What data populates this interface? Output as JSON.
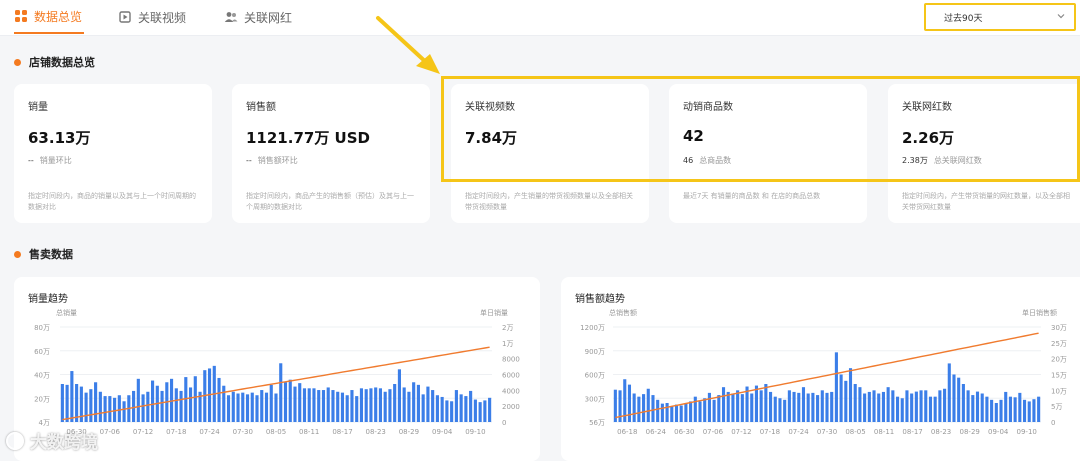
{
  "tabs": [
    {
      "label": "数据总览",
      "icon": "grid-icon"
    },
    {
      "label": "关联视频",
      "icon": "video-icon"
    },
    {
      "label": "关联网红",
      "icon": "users-icon"
    }
  ],
  "period": {
    "value": "过去90天"
  },
  "sections": {
    "overview": "店铺数据总览",
    "sales": "售卖数据"
  },
  "cards": [
    {
      "label": "销量",
      "value": "63.13万",
      "sub_value": "--",
      "sub_label": "销量环比",
      "desc": "指定时间段内，商品的销量以及其与上一个时间周期的数据对比"
    },
    {
      "label": "销售额",
      "value": "1121.77万 USD",
      "sub_value": "--",
      "sub_label": "销售额环比",
      "desc": "指定时间段内，商品产生的销售额（预估）及其与上一个周期的数据对比"
    },
    {
      "label": "关联视频数",
      "value": "7.84万",
      "sub_value": "",
      "sub_label": "",
      "desc": "指定时间段内，产生销量的带货视频数量以及全部相关带货视频数量"
    },
    {
      "label": "动销商品数",
      "value": "42",
      "sub_value": "46",
      "sub_label": "总商品数",
      "desc": "最近7天 有销量的商品数 和 在店的商品总数"
    },
    {
      "label": "关联网红数",
      "value": "2.26万",
      "sub_value": "2.38万",
      "sub_label": "总关联网红数",
      "desc": "指定时间段内，产生带货销量的网红数量，以及全部相关带货网红数量"
    }
  ],
  "watermark": "大数跨境",
  "colors": {
    "accent": "#f47a20",
    "bar": "#3b7ee8",
    "line": "#f07b2f",
    "highlight": "#f5c518"
  },
  "chart_data": [
    {
      "type": "bar",
      "title": "销量趋势",
      "ylabel_left": "总销量",
      "ylabel_right": "单日销量",
      "left_ticks": [
        "80万",
        "60万",
        "40万",
        "20万",
        "4万"
      ],
      "right_ticks": [
        "2万",
        "1万",
        "8000",
        "6000",
        "4000",
        "2000",
        "0"
      ],
      "categories": [
        "06-30",
        "07-06",
        "07-12",
        "07-18",
        "07-24",
        "07-30",
        "08-05",
        "08-11",
        "08-17",
        "08-23",
        "08-29",
        "09-04",
        "09-10"
      ],
      "series": [
        {
          "name": "单日销量",
          "type": "bar",
          "values": [
            4400,
            4300,
            5900,
            4400,
            4100,
            3400,
            3800,
            4600,
            3500,
            3000,
            3000,
            2800,
            3100,
            2400,
            3100,
            3600,
            5000,
            3200,
            3500,
            4800,
            4200,
            3600,
            4600,
            5000,
            3900,
            3600,
            5200,
            4000,
            5300,
            3500,
            6000,
            6200,
            6500,
            5100,
            4200,
            3100,
            3500,
            3300,
            3400,
            3200,
            3400,
            3100,
            3700,
            3400,
            4300,
            3300,
            6800,
            4600,
            4900,
            4100,
            4500,
            3900,
            3900,
            3900,
            3700,
            3700,
            4000,
            3700,
            3500,
            3400,
            3100,
            3700,
            3000,
            3900,
            3800,
            3900,
            4000,
            3900,
            3500,
            3800,
            4400,
            6100,
            4000,
            3500,
            4600,
            4300,
            3200,
            4100,
            3700,
            3100,
            2900,
            2500,
            2400,
            3700,
            3200,
            3000,
            3600,
            2600,
            2300,
            2500,
            2800
          ]
        },
        {
          "name": "总销量",
          "type": "line",
          "values": [
            20000,
            630000
          ]
        }
      ]
    },
    {
      "type": "bar",
      "title": "销售额趋势",
      "ylabel_left": "总销售额",
      "ylabel_right": "单日销售额",
      "left_ticks": [
        "1200万",
        "900万",
        "600万",
        "300万",
        "56万"
      ],
      "right_ticks": [
        "30万",
        "25万",
        "20万",
        "15万",
        "10万",
        "5万",
        "0"
      ],
      "categories": [
        "06-18",
        "06-24",
        "06-30",
        "07-06",
        "07-12",
        "07-18",
        "07-24",
        "07-30",
        "08-05",
        "08-11",
        "08-17",
        "08-23",
        "08-29",
        "09-04",
        "09-10"
      ],
      "series": [
        {
          "name": "单日销售额",
          "type": "bar",
          "values": [
            102000,
            100000,
            135000,
            118000,
            90000,
            80000,
            88000,
            105000,
            85000,
            70000,
            58000,
            60000,
            50000,
            55000,
            52000,
            58000,
            65000,
            80000,
            65000,
            75000,
            92000,
            70000,
            85000,
            110000,
            95000,
            90000,
            100000,
            88000,
            112000,
            90000,
            115000,
            100000,
            120000,
            95000,
            80000,
            75000,
            70000,
            100000,
            95000,
            92000,
            110000,
            90000,
            92000,
            85000,
            100000,
            92000,
            95000,
            220000,
            150000,
            130000,
            170000,
            120000,
            110000,
            90000,
            95000,
            100000,
            90000,
            95000,
            110000,
            100000,
            80000,
            75000,
            100000,
            90000,
            96000,
            100000,
            100000,
            80000,
            80000,
            100000,
            105000,
            185000,
            150000,
            140000,
            120000,
            100000,
            85000,
            96000,
            90000,
            80000,
            70000,
            60000,
            70000,
            95000,
            80000,
            78000,
            92000,
            70000,
            65000,
            72000,
            80000
          ]
        },
        {
          "name": "总销售额",
          "type": "line",
          "values": [
            560000,
            11217700
          ]
        }
      ]
    }
  ]
}
